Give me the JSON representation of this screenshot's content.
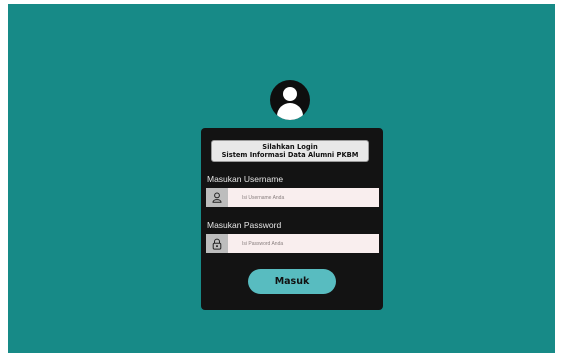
{
  "page": {
    "background_color": "#178a87",
    "card_color": "#131313",
    "button_color": "#58bcc0"
  },
  "header": {
    "avatar_icon": "user-avatar-icon",
    "title_line1": "Silahkan Login",
    "title_line2": "Sistem Informasi Data Alumni PKBM"
  },
  "form": {
    "username": {
      "label": "Masukan Username",
      "placeholder": "Isi Username Anda",
      "value": "",
      "icon": "user-icon"
    },
    "password": {
      "label": "Masukan Password",
      "placeholder": "Isi Password Anda",
      "value": "",
      "icon": "lock-icon"
    },
    "submit_label": "Masuk"
  }
}
